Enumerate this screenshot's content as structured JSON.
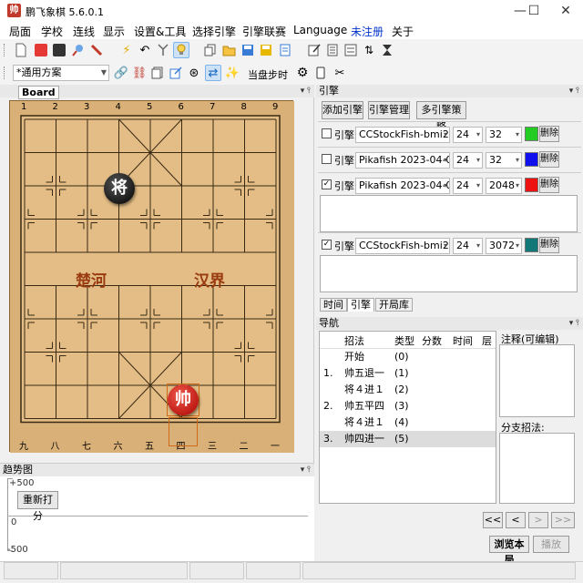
{
  "window": {
    "title": "鹏飞象棋 5.6.0.1",
    "app_icon_text": "帅",
    "minimize": "—",
    "maximize": "☐",
    "close": "✕"
  },
  "menu": [
    "局面",
    "学校",
    "连线",
    "显示",
    "设置&工具",
    "选择引擎",
    "引擎联赛",
    "Language",
    "未注册",
    "关于"
  ],
  "menu_accent": "#0033cc",
  "toolbar2": {
    "scheme": "*通用方案",
    "step_label": "当盘步时"
  },
  "board_panel": {
    "title": "Board",
    "tab_label": "Board",
    "files_top": [
      "1",
      "2",
      "3",
      "4",
      "5",
      "6",
      "7",
      "8",
      "9"
    ],
    "files_bottom": [
      "九",
      "八",
      "七",
      "六",
      "五",
      "四",
      "三",
      "二",
      "一"
    ],
    "river_left": "楚河",
    "river_right": "汉界",
    "pieces": [
      {
        "char": "将",
        "side": "black",
        "name": "black-king"
      },
      {
        "char": "帅",
        "side": "red",
        "name": "red-king"
      }
    ]
  },
  "trend": {
    "title": "趋势图",
    "reset_button": "重新打分",
    "y_top": "+500",
    "y_mid": "0",
    "y_bottom": "-500"
  },
  "engine_panel": {
    "title": "引擎",
    "buttons": [
      "添加引擎",
      "引擎管理",
      "多引擎策略"
    ],
    "engines": [
      {
        "checked": false,
        "label": "引擎",
        "name": "CCStockFish-bmi2",
        "threads": "24",
        "hash": "32",
        "color": "#22cc22",
        "delete": "删除",
        "has_output": false
      },
      {
        "checked": false,
        "label": "引擎",
        "name": "Pikafish 2023-04-0",
        "threads": "24",
        "hash": "32",
        "color": "#1010ee",
        "delete": "删除",
        "has_output": false
      },
      {
        "checked": true,
        "label": "引擎",
        "name": "Pikafish 2023-04-0",
        "threads": "24",
        "hash": "2048",
        "color": "#ee1111",
        "delete": "删除",
        "has_output": true
      },
      {
        "checked": true,
        "label": "引擎",
        "name": "CCStockFish-bmi2",
        "threads": "24",
        "hash": "3072",
        "color": "#117777",
        "delete": "删除",
        "has_output": true
      }
    ],
    "tabs": [
      "时间",
      "引擎",
      "开局库"
    ]
  },
  "nav_panel": {
    "title": "导航",
    "headers": {
      "move": "招法",
      "type": "类型",
      "score": "分数",
      "time": "时间",
      "depth": "层"
    },
    "rows": [
      {
        "num": "",
        "move": "开始",
        "type": "(0)"
      },
      {
        "num": "1.",
        "move": "帅五退一",
        "type": "(1)"
      },
      {
        "num": "",
        "move": "将４进１",
        "type": "(2)"
      },
      {
        "num": "2.",
        "move": "帅五平四",
        "type": "(3)"
      },
      {
        "num": "",
        "move": "将４进１",
        "type": "(4)"
      },
      {
        "num": "3.",
        "move": "帅四进一",
        "type": "(5)"
      }
    ],
    "comment_label": "注释(可编辑)",
    "branch_label": "分支招法:",
    "nav_buttons": [
      "<<",
      "<",
      ">",
      ">>"
    ],
    "browse_button": "浏览本局",
    "play_button": "播放"
  }
}
